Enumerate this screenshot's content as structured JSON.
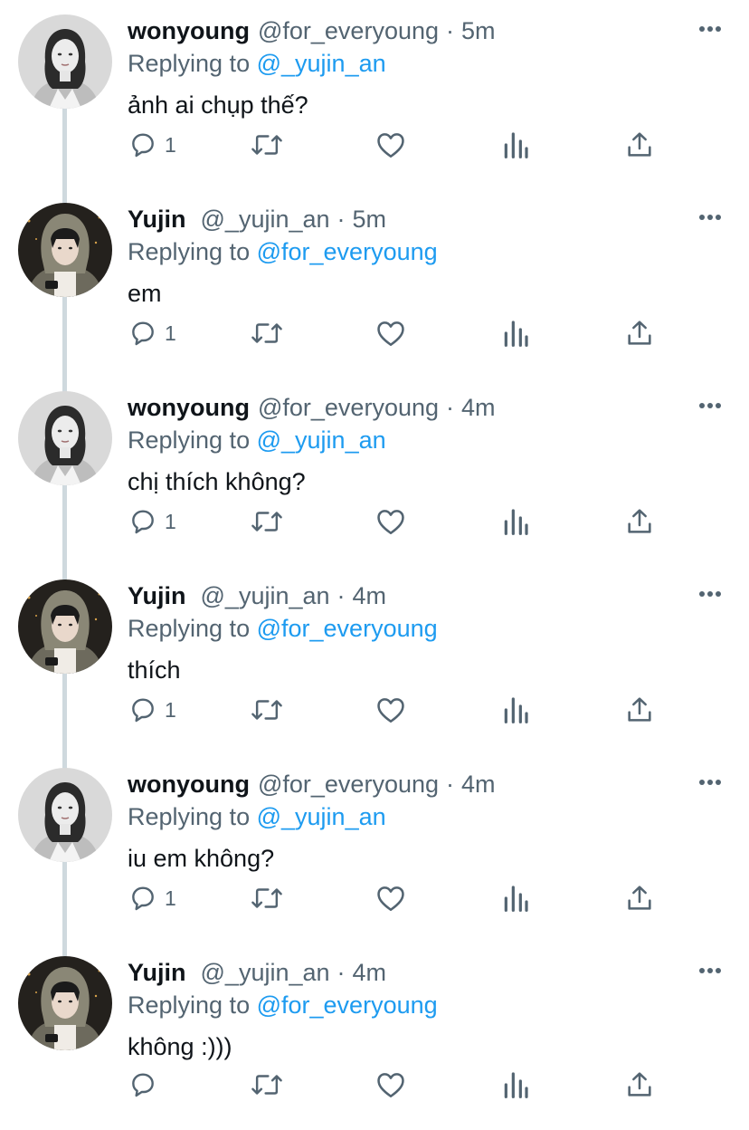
{
  "colors": {
    "text_primary": "#0f1419",
    "text_secondary": "#536471",
    "mention": "#1d9bf0",
    "thread_line": "#cfd9de",
    "icon": "#536471"
  },
  "tweets": [
    {
      "name": "wonyoung",
      "handle": "@for_everyoung",
      "dot": "·",
      "time": "5m",
      "replying_prefix": "Replying to",
      "replying_to": "@_yujin_an",
      "text": "ảnh ai chụp thế?",
      "reply_count": "1",
      "avatar": "wonyoung-avatar"
    },
    {
      "name": "Yujin",
      "handle": "@_yujin_an",
      "dot": "·",
      "time": "5m",
      "replying_prefix": "Replying to",
      "replying_to": "@for_everyoung",
      "text": "em",
      "reply_count": "1",
      "avatar": "yujin-avatar"
    },
    {
      "name": "wonyoung",
      "handle": "@for_everyoung",
      "dot": "·",
      "time": "4m",
      "replying_prefix": "Replying to",
      "replying_to": "@_yujin_an",
      "text": "chị thích không?",
      "reply_count": "1",
      "avatar": "wonyoung-avatar"
    },
    {
      "name": "Yujin",
      "handle": "@_yujin_an",
      "dot": "·",
      "time": "4m",
      "replying_prefix": "Replying to",
      "replying_to": "@for_everyoung",
      "text": "thích",
      "reply_count": "1",
      "avatar": "yujin-avatar"
    },
    {
      "name": "wonyoung",
      "handle": "@for_everyoung",
      "dot": "·",
      "time": "4m",
      "replying_prefix": "Replying to",
      "replying_to": "@_yujin_an",
      "text": "iu em không?",
      "reply_count": "1",
      "avatar": "wonyoung-avatar"
    },
    {
      "name": "Yujin",
      "handle": "@_yujin_an",
      "dot": "·",
      "time": "4m",
      "replying_prefix": "Replying to",
      "replying_to": "@for_everyoung",
      "text": "không :)))",
      "reply_count": "",
      "avatar": "yujin-avatar"
    }
  ],
  "action_icons": [
    "reply-icon",
    "retweet-icon",
    "like-icon",
    "views-icon",
    "share-icon"
  ],
  "menu_icon": "more-options-icon"
}
